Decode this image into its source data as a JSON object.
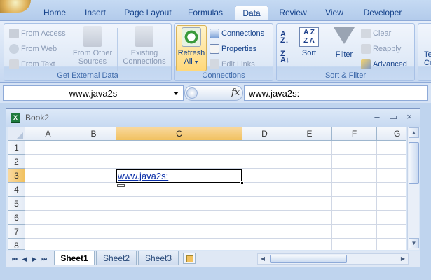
{
  "tabs": [
    {
      "label": "Home"
    },
    {
      "label": "Insert"
    },
    {
      "label": "Page Layout"
    },
    {
      "label": "Formulas"
    },
    {
      "label": "Data"
    },
    {
      "label": "Review"
    },
    {
      "label": "View"
    },
    {
      "label": "Developer"
    }
  ],
  "ribbon": {
    "get_external_data": {
      "label": "Get External Data",
      "from_access": "From Access",
      "from_web": "From Web",
      "from_text": "From Text",
      "from_other_l1": "From Other",
      "from_other_l2": "Sources",
      "existing_l1": "Existing",
      "existing_l2": "Connections"
    },
    "connections": {
      "label": "Connections",
      "refresh_l1": "Refresh",
      "refresh_l2": "All",
      "connections": "Connections",
      "properties": "Properties",
      "edit_links": "Edit Links"
    },
    "sort_filter": {
      "label": "Sort & Filter",
      "sort": "Sort",
      "filter": "Filter",
      "clear": "Clear",
      "reapply": "Reapply",
      "advanced": "Advanced",
      "az": "A Z",
      "za": "Z A"
    },
    "partial_group": {
      "l1": "Te",
      "l2": "Co"
    }
  },
  "formula_bar": {
    "name_box": "www.java2s",
    "fx": "fx",
    "content": "www.java2s:"
  },
  "workbook": {
    "title": "Book2",
    "icon": "X",
    "controls": {
      "minimize": "–",
      "restore": "▭",
      "close": "×"
    },
    "columns": [
      "A",
      "B",
      "C",
      "D",
      "E",
      "F",
      "G"
    ],
    "rows": [
      "1",
      "2",
      "3",
      "4",
      "5",
      "6",
      "7",
      "8"
    ],
    "selected_column": "C",
    "selected_row": "3",
    "cells": {
      "C3": "www.java2s:"
    },
    "sheets": [
      "Sheet1",
      "Sheet2",
      "Sheet3"
    ],
    "active_sheet": "Sheet1"
  },
  "colors": {
    "accent": "#15428b",
    "selected_header": "#f1c15f",
    "hyperlink": "#0b2fa8"
  }
}
